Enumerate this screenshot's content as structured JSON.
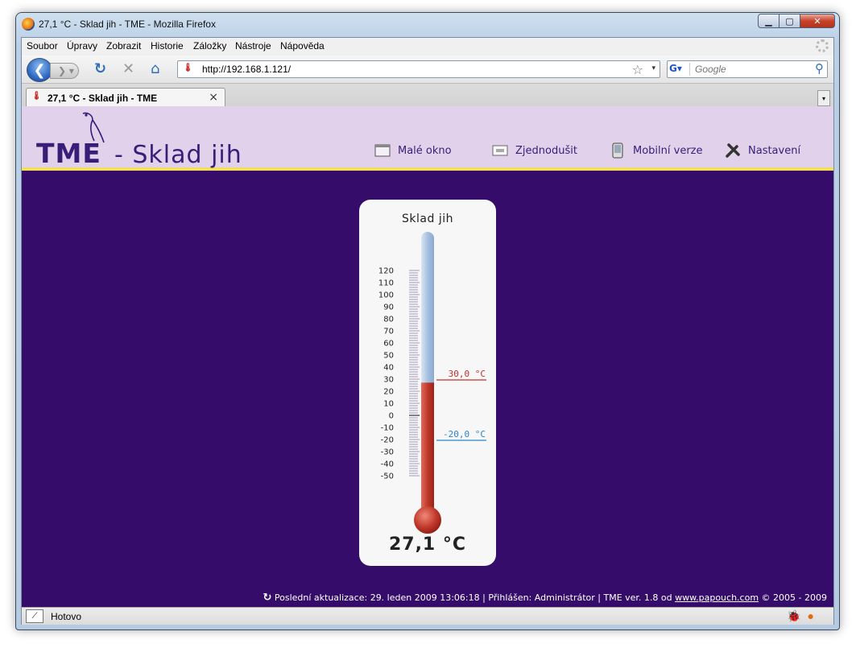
{
  "window": {
    "title": "27,1 °C - Sklad jih - TME - Mozilla Firefox"
  },
  "menu": [
    "Soubor",
    "Úpravy",
    "Zobrazit",
    "Historie",
    "Záložky",
    "Nástroje",
    "Nápověda"
  ],
  "nav": {
    "url": "http://192.168.1.121/",
    "search_placeholder": "Google"
  },
  "tab": {
    "label": "27,1 °C - Sklad jih - TME",
    "close": "×"
  },
  "header": {
    "logo": "TME",
    "title": "- Sklad jih",
    "links": [
      {
        "label": "Malé okno",
        "icon": "small-window-icon"
      },
      {
        "label": "Zjednodušit",
        "icon": "simplify-icon"
      },
      {
        "label": "Mobilní verze",
        "icon": "mobile-icon"
      },
      {
        "label": "Nastavení",
        "icon": "settings-icon"
      }
    ]
  },
  "thermometer": {
    "title": "Sklad jih",
    "value": 27.1,
    "value_text": "27,1 °C",
    "scale": [
      120,
      110,
      100,
      90,
      80,
      70,
      60,
      50,
      40,
      30,
      20,
      10,
      0,
      -10,
      -20,
      -30,
      -40,
      -50
    ],
    "high_limit": {
      "value": 30,
      "label": "30,0 °C",
      "color": "#c0302a"
    },
    "low_limit": {
      "value": -20,
      "label": "-20,0 °C",
      "color": "#2a86c8"
    },
    "mercury_color": "#c0392b"
  },
  "footer": {
    "update_label": "Poslední aktualizace: 29. leden 2009 13:06:18",
    "logged_in": "Přihlášen: Administrátor",
    "version": "TME ver. 1.8 od",
    "link": "www.papouch.com",
    "copyright": "© 2005 - 2009"
  },
  "status": {
    "text": "Hotovo"
  }
}
